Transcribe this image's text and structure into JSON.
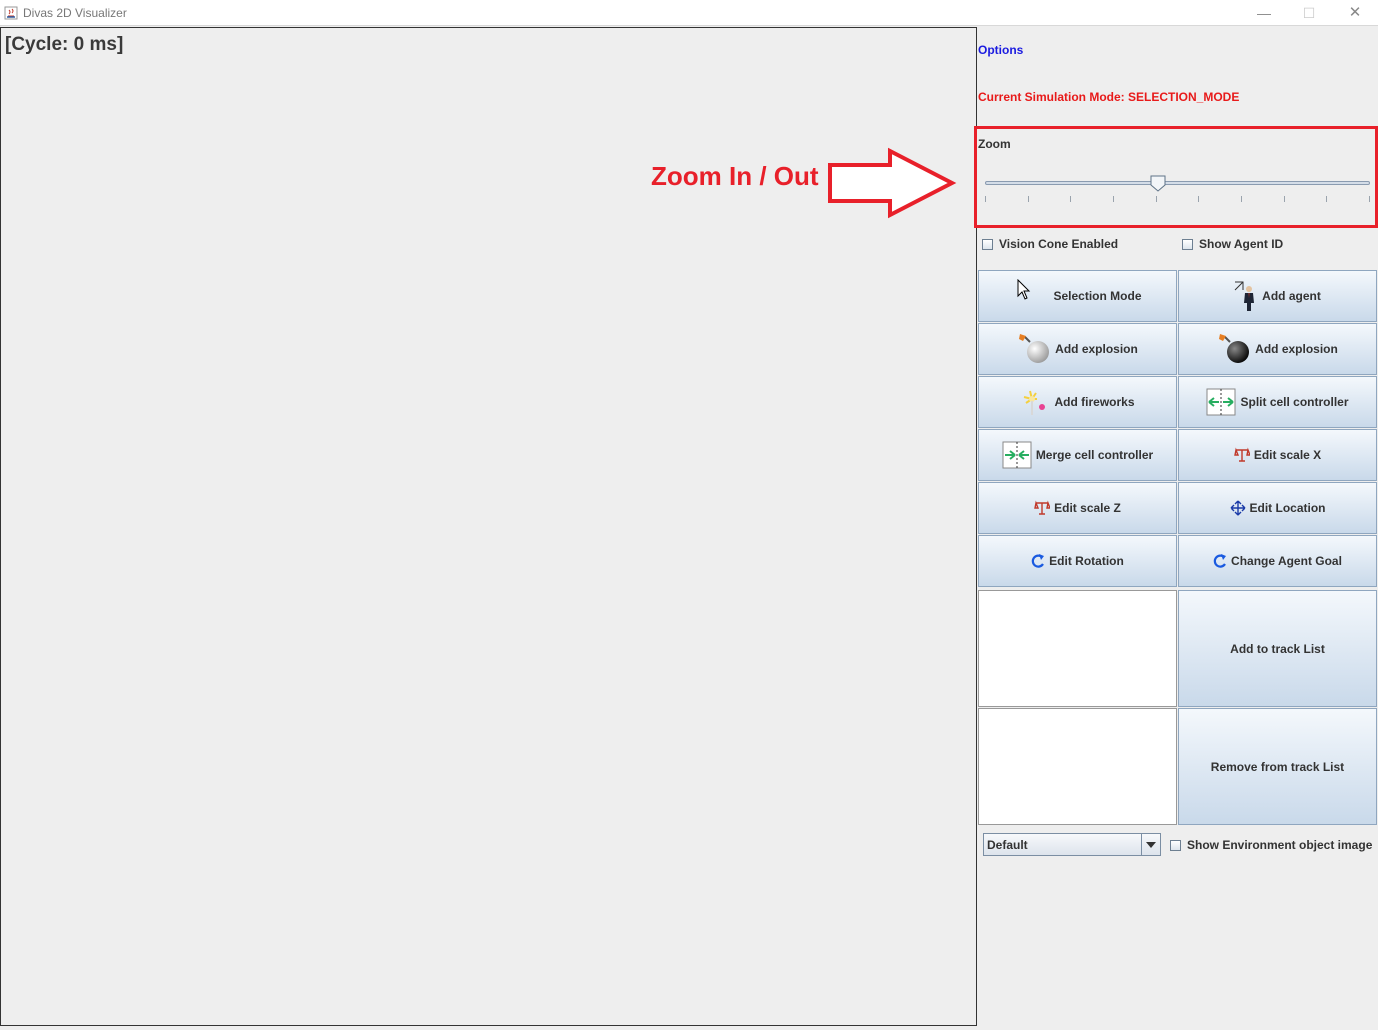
{
  "window": {
    "title": "Divas 2D Visualizer",
    "controls": {
      "minimize": "—",
      "maximize": "☐",
      "close": "✕"
    }
  },
  "canvas": {
    "cycle_label": "[Cycle: 0 ms]"
  },
  "panel": {
    "options_label": "Options",
    "mode_label": "Current Simulation Mode: SELECTION_MODE",
    "zoom_label": "Zoom",
    "zoom_value": 0.45,
    "vision_cone_label": "Vision Cone Enabled",
    "show_agent_id_label": "Show Agent ID",
    "buttons": [
      {
        "label": "Selection Mode",
        "icon": "cursor-icon"
      },
      {
        "label": "Add agent",
        "icon": "agent-icon"
      },
      {
        "label": "Add explosion",
        "icon": "white-bomb-icon"
      },
      {
        "label": "Add explosion",
        "icon": "black-bomb-icon"
      },
      {
        "label": "Add fireworks",
        "icon": "fireworks-icon"
      },
      {
        "label": "Split cell controller",
        "icon": "split-icon"
      },
      {
        "label": "Merge cell controller",
        "icon": "merge-icon"
      },
      {
        "label": "Edit scale X",
        "icon": "scale-icon"
      },
      {
        "label": "Edit scale Z",
        "icon": "scale-icon"
      },
      {
        "label": "Edit Location",
        "icon": "move-icon"
      },
      {
        "label": "Edit Rotation",
        "icon": "rotate-icon"
      },
      {
        "label": "Change Agent Goal",
        "icon": "rotate-icon"
      }
    ],
    "add_track_label": "Add to track List",
    "remove_track_label": "Remove from track List",
    "combo_value": "Default",
    "show_env_label": "Show Environment object image"
  },
  "annotation": {
    "callout_text": "Zoom In / Out"
  },
  "colors": {
    "accent_red": "#e8202a",
    "link_blue": "#1a1ae0",
    "mode_red": "#e81a1a"
  }
}
